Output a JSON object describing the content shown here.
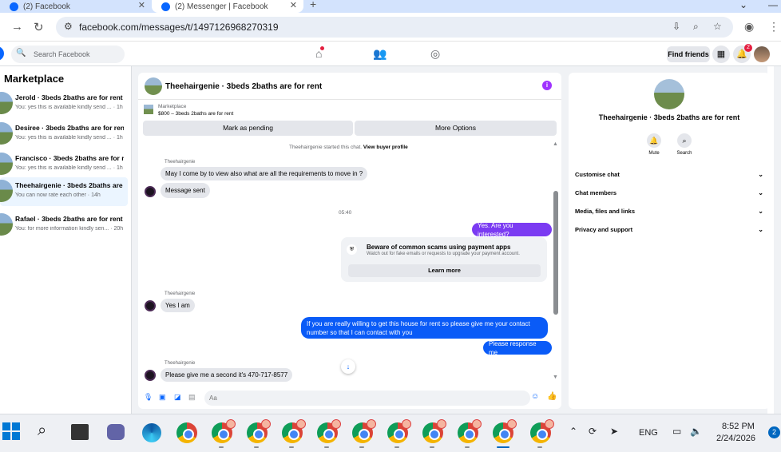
{
  "browser": {
    "tabs": [
      {
        "title": "(2) Facebook"
      },
      {
        "title": "(2) Messenger | Facebook"
      }
    ],
    "url": "facebook.com/messages/t/1497126968270319"
  },
  "fb_header": {
    "search_placeholder": "Search Facebook",
    "find_friends": "Find friends",
    "notification_count": "2"
  },
  "marketplace": {
    "title": "Marketplace",
    "conversations": [
      {
        "name": "Jerold · 3beds 2baths are for rent",
        "preview": "You: yes this is available kindly send ... · 1h"
      },
      {
        "name": "Desiree · 3beds 2baths are for rent",
        "preview": "You: yes this is available kindly send ... · 1h"
      },
      {
        "name": "Francisco · 3beds 2baths are for rent",
        "preview": "You: yes this is available kindly send ... · 1h"
      },
      {
        "name": "Theehairgenie · 3beds 2baths are f...",
        "preview": "You can now rate each other · 14h"
      },
      {
        "name": "Rafael · 3beds 2baths are for rent",
        "preview": "You: for more information kindly sen... · 20h"
      }
    ]
  },
  "chat": {
    "title": "Theehairgenie · 3beds 2baths are for rent",
    "marketplace_label": "Marketplace",
    "listing": "$800 – 3beds 2baths are for rent",
    "mark_pending": "Mark as pending",
    "more_options": "More Options",
    "system_text": "Theehairgenie started this chat.",
    "view_buyer": "View buyer profile",
    "sender": "Theehairgenie",
    "msg1": "May I come by to view also what are all the requirements to move in ?",
    "msg2": "Message sent",
    "time": "05:40",
    "msg3": "Yes. Are you interested?",
    "scam_title": "Beware of common scams using payment apps",
    "scam_sub": "Watch out for fake emails or requests to upgrade your payment account.",
    "learn_more": "Learn more",
    "msg4": "Yes I am",
    "msg5": "If you are really willing to get this house for rent so please give me your contact number so that I can  contact with you",
    "msg6": "Please response me",
    "msg7": "Please give me a second it's 470-717-8577",
    "compose_placeholder": "Aa"
  },
  "details": {
    "name": "Theehairgenie · 3beds 2baths are for rent",
    "mute": "Mute",
    "search": "Search",
    "sections": [
      "Customise chat",
      "Chat members",
      "Media, files and links",
      "Privacy and support"
    ]
  },
  "taskbar": {
    "lang": "ENG",
    "time": "8:52 PM",
    "date": "2/24/2026",
    "notifications": "2"
  }
}
